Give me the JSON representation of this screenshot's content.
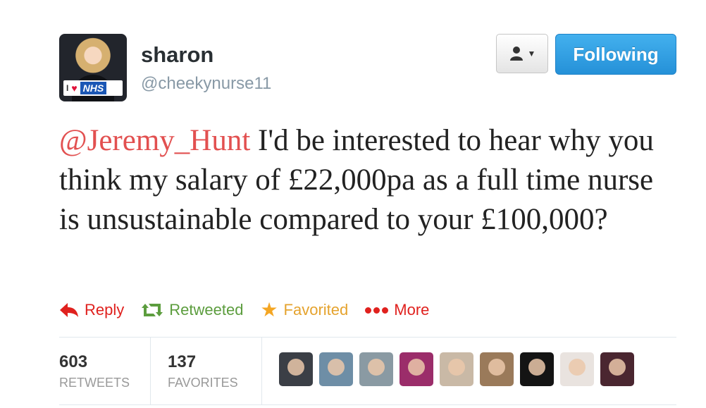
{
  "user": {
    "name": "sharon",
    "handle": "@cheekynurse11",
    "avatar_badge": "NHS",
    "avatar_badge_prefix": "I"
  },
  "buttons": {
    "follow_menu_icon": "person-icon",
    "following_label": "Following"
  },
  "tweet": {
    "mention": "@Jeremy_Hunt",
    "body": " I'd be interested to hear why you think my salary of £22,000pa as a full time nurse is unsustainable compared to your £100,000?"
  },
  "actions": {
    "reply": "Reply",
    "retweeted": "Retweeted",
    "favorited": "Favorited",
    "more": "More"
  },
  "stats": {
    "retweets_count": "603",
    "retweets_label": "RETWEETS",
    "favorites_count": "137",
    "favorites_label": "FAVORITES"
  },
  "favoriters": [
    {
      "color": "#3b3f46"
    },
    {
      "color": "#6e8ea6"
    },
    {
      "color": "#8a9aa3"
    },
    {
      "color": "#9b2d6a"
    },
    {
      "color": "#c9b9a6"
    },
    {
      "color": "#9a7a5a"
    },
    {
      "color": "#141414"
    },
    {
      "color": "#e9e3df"
    },
    {
      "color": "#4a2630"
    }
  ],
  "colors": {
    "mention": "#e25050",
    "reply": "#e0211e",
    "retweet": "#5c9d3e",
    "favorite": "#e5a32e",
    "following_button": "#2591d8"
  }
}
